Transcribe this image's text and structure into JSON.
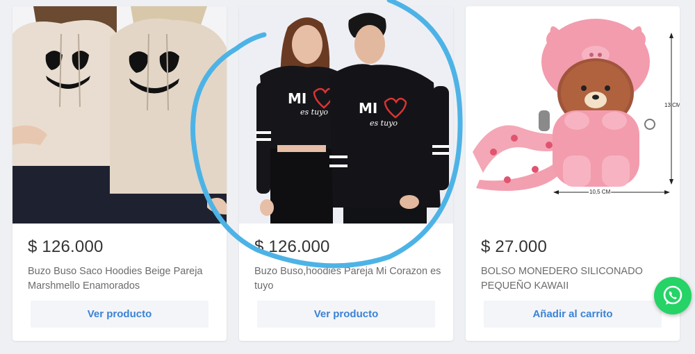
{
  "products": [
    {
      "price": "$ 126.000",
      "title": "Buzo Buso Saco Hoodies Beige Pareja Marshmello Enamorados",
      "button": "Ver producto",
      "image": "beige-hoodies-couple-photo"
    },
    {
      "price": "$ 126.000",
      "title": "Buzo Buso,hoodies Pareja Mi Corazon es tuyo",
      "button": "Ver producto",
      "image": "black-hoodies-couple-photo",
      "print_main": "MI",
      "print_sub": "es tuyo"
    },
    {
      "price": "$ 27.000",
      "title": "BOLSO MONEDERO SILICONADO PEQUEÑO KAWAII",
      "button": "Añadir al carrito",
      "image": "pink-bear-coin-purse-photo",
      "dim_height": "13 CM",
      "dim_width": "10,5 CM"
    }
  ],
  "whatsapp": {
    "icon": "whatsapp-icon",
    "color": "#25d366"
  },
  "annotation": {
    "color": "#4db3e6"
  }
}
